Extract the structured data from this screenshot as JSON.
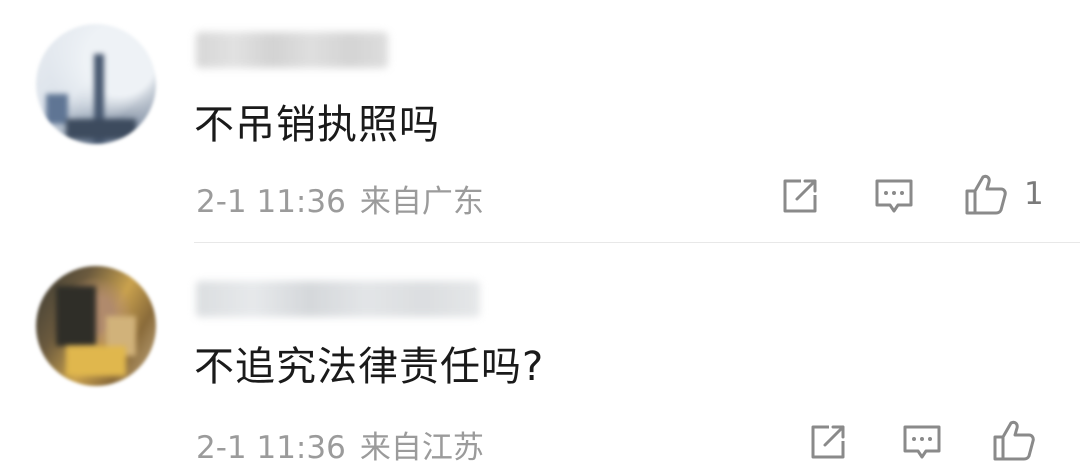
{
  "comments": [
    {
      "text": "不吊销执照吗",
      "time": "2-1 11:36",
      "location": "来自广东",
      "like_count": "1"
    },
    {
      "text": "不追究法律责任吗?",
      "time": "2-1 11:36",
      "location": "来自江苏",
      "like_count": ""
    }
  ],
  "icons": {
    "share": "share-icon",
    "reply": "reply-icon",
    "like": "thumbs-up-icon"
  },
  "colors": {
    "text": "#1a1a1a",
    "meta": "#9b9b9b",
    "icon": "#8a8a8a",
    "divider": "#e8e8e8"
  }
}
